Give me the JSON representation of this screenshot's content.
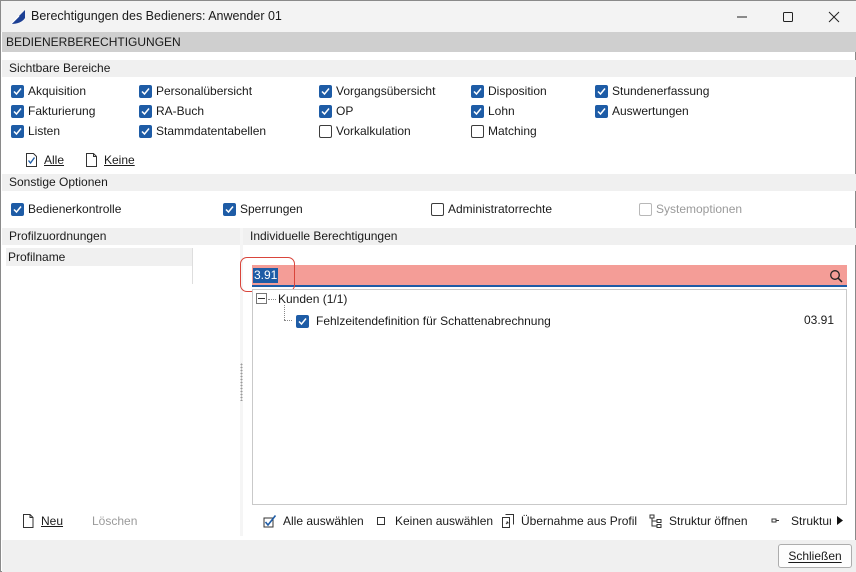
{
  "window": {
    "title": "Berechtigungen des Bedieners: Anwender 01"
  },
  "banner": "BEDIENERBERECHTIGUNGEN",
  "sichtbare_bereiche": {
    "header": "Sichtbare Bereiche",
    "items": [
      {
        "label": "Akquisition",
        "checked": true
      },
      {
        "label": "Personalübersicht",
        "checked": true
      },
      {
        "label": "Vorgangsübersicht",
        "checked": true
      },
      {
        "label": "Disposition",
        "checked": true
      },
      {
        "label": "Stundenerfassung",
        "checked": true
      },
      {
        "label": "Fakturierung",
        "checked": true
      },
      {
        "label": "RA-Buch",
        "checked": true
      },
      {
        "label": "OP",
        "checked": true
      },
      {
        "label": "Lohn",
        "checked": true
      },
      {
        "label": "Auswertungen",
        "checked": true
      },
      {
        "label": "Listen",
        "checked": true
      },
      {
        "label": "Stammdatentabellen",
        "checked": true
      },
      {
        "label": "Vorkalkulation",
        "checked": false
      },
      {
        "label": "Matching",
        "checked": false
      }
    ],
    "alle_label": "Alle",
    "keine_label": "Keine"
  },
  "sonstige_optionen": {
    "header": "Sonstige Optionen",
    "items": [
      {
        "label": "Bedienerkontrolle",
        "checked": true
      },
      {
        "label": "Sperrungen",
        "checked": true
      },
      {
        "label": "Administratorrechte",
        "checked": false
      },
      {
        "label": "Systemoptionen",
        "checked": false,
        "disabled": true
      }
    ]
  },
  "profilzuordnungen": {
    "header": "Profilzuordnungen",
    "column": "Profilname",
    "new_label": "Neu",
    "delete_label": "Löschen"
  },
  "individuelle": {
    "header": "Individuelle Berechtigungen",
    "search_value": "3.91",
    "tree": {
      "group_label": "Kunden (1/1)",
      "item_label": "Fehlzeitendefinition für Schattenabrechnung",
      "item_value": "03.91",
      "item_checked": true
    },
    "toolbar": {
      "select_all": "Alle auswählen",
      "select_none": "Keinen auswählen",
      "take_profile": "Übernahme aus Profil",
      "open_structure": "Struktur öffnen",
      "structure_cut": "Struktur"
    }
  },
  "close_label": "Schließen",
  "colors": {
    "accent": "#1e5ca6",
    "search_bg": "#f49d97",
    "highlight_border": "#d9453b"
  }
}
